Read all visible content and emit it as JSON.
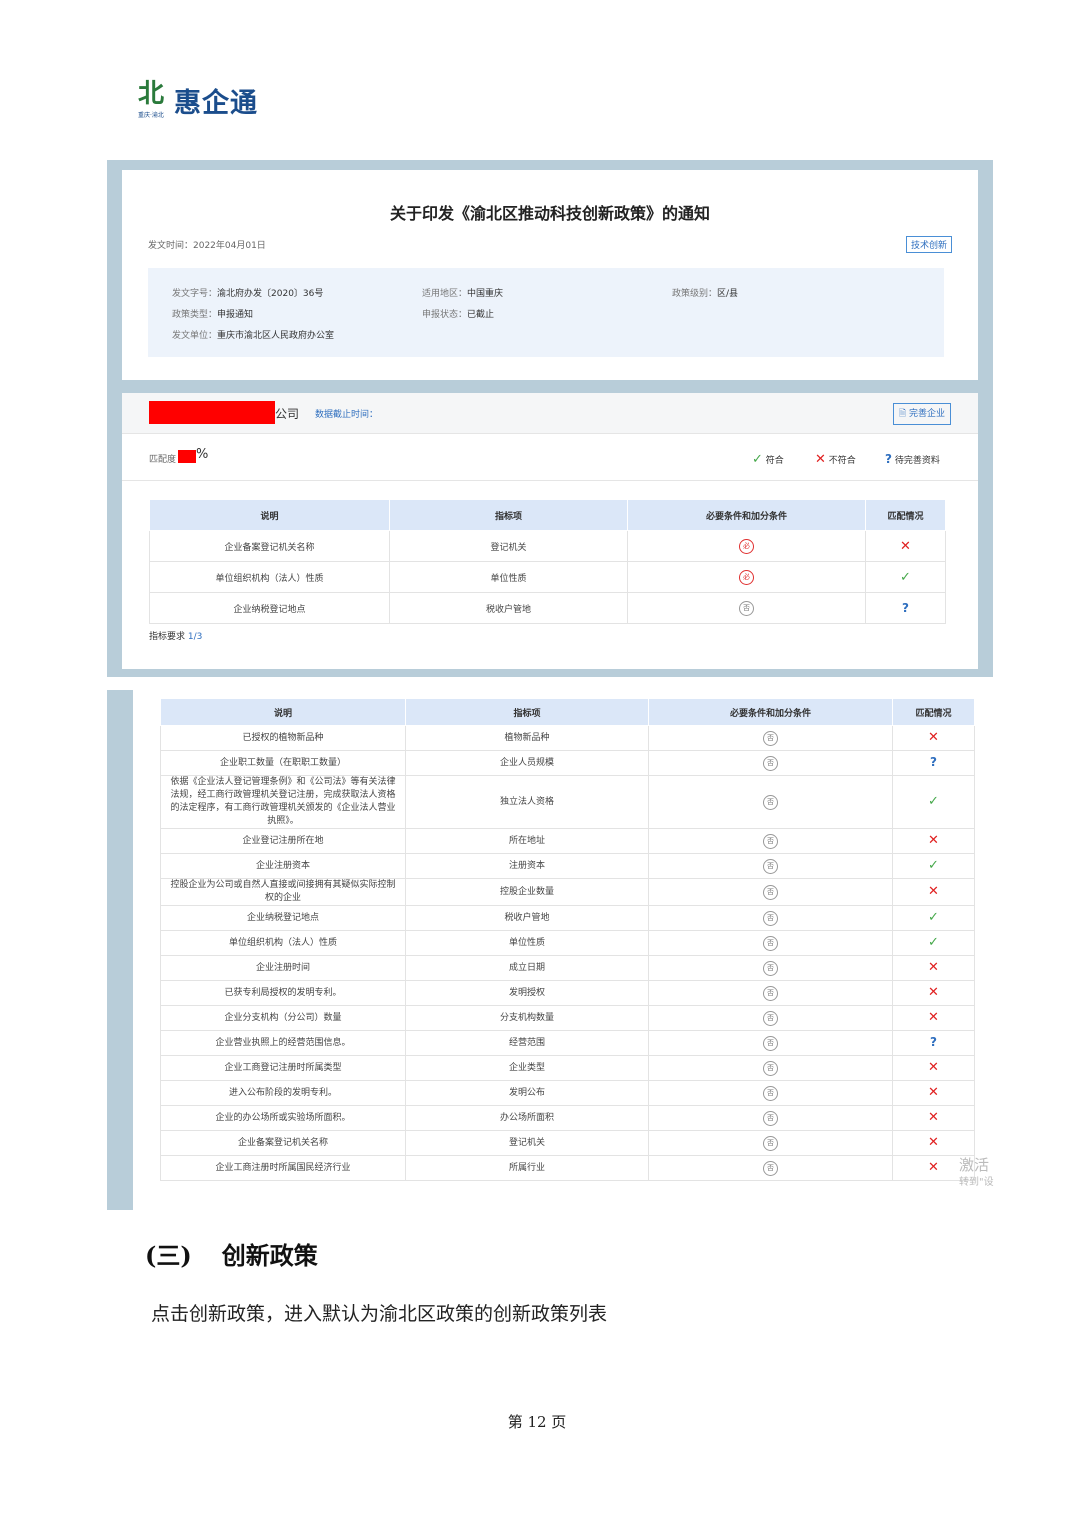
{
  "logo": {
    "glyph": "北",
    "sub": "重庆·渝北",
    "name": "惠企通"
  },
  "policy": {
    "title": "关于印发《渝北区推动科技创新政策》的通知",
    "date_label": "发文时间：2022年04月01日",
    "tag": "技术创新",
    "fields": {
      "doc_no_k": "发文字号：",
      "doc_no_v": "渝北府办发〔2020〕36号",
      "region_k": "适用地区：",
      "region_v": "中国重庆",
      "level_k": "政策级别：",
      "level_v": "区/县",
      "type_k": "政策类型：",
      "type_v": "申报通知",
      "status_k": "申报状态：",
      "status_v": "已截止",
      "issuer_k": "发文单位：",
      "issuer_v": "重庆市渝北区人民政府办公室"
    }
  },
  "match": {
    "company_suffix": "公司",
    "deadline_label": "数据截止时间：",
    "perfect_button": "完善企业",
    "degree_label": "匹配度",
    "degree_suffix": "%",
    "legend": {
      "ok": "符合",
      "no": "不符合",
      "pending": "待完善资料"
    },
    "headers": [
      "说明",
      "指标项",
      "必要条件和加分条件",
      "匹配情况"
    ],
    "rows": [
      {
        "desc": "企业备案登记机关名称",
        "item": "登记机关",
        "cond": "必",
        "status": "no"
      },
      {
        "desc": "单位组织机构（法人）性质",
        "item": "单位性质",
        "cond": "必",
        "status": "ok"
      },
      {
        "desc": "企业纳税登记地点",
        "item": "税收户管地",
        "cond": "否",
        "status": "pending"
      }
    ],
    "requirement_label": "指标要求",
    "requirement_value": "1/3"
  },
  "table2": {
    "headers": [
      "说明",
      "指标项",
      "必要条件和加分条件",
      "匹配情况"
    ],
    "rows": [
      {
        "desc": "已授权的植物新品种",
        "item": "植物新品种",
        "cond": "否",
        "status": "no"
      },
      {
        "desc": "企业职工数量（在职职工数量）",
        "item": "企业人员规模",
        "cond": "否",
        "status": "pending"
      },
      {
        "desc": "依据《企业法人登记管理条例》和《公司法》等有关法律法规，经工商行政管理机关登记注册，完成获取法人资格的法定程序，有工商行政管理机关颁发的《企业法人营业执照》。",
        "item": "独立法人资格",
        "cond": "否",
        "status": "ok"
      },
      {
        "desc": "企业登记注册所在地",
        "item": "所在地址",
        "cond": "否",
        "status": "no"
      },
      {
        "desc": "企业注册资本",
        "item": "注册资本",
        "cond": "否",
        "status": "ok"
      },
      {
        "desc": "控股企业为公司或自然人直接或间接拥有其疑似实际控制权的企业",
        "item": "控股企业数量",
        "cond": "否",
        "status": "no"
      },
      {
        "desc": "企业纳税登记地点",
        "item": "税收户管地",
        "cond": "否",
        "status": "ok"
      },
      {
        "desc": "单位组织机构（法人）性质",
        "item": "单位性质",
        "cond": "否",
        "status": "ok"
      },
      {
        "desc": "企业注册时间",
        "item": "成立日期",
        "cond": "否",
        "status": "no"
      },
      {
        "desc": "已获专利局授权的发明专利。",
        "item": "发明授权",
        "cond": "否",
        "status": "no"
      },
      {
        "desc": "企业分支机构（分公司）数量",
        "item": "分支机构数量",
        "cond": "否",
        "status": "no"
      },
      {
        "desc": "企业营业执照上的经营范围信息。",
        "item": "经营范围",
        "cond": "否",
        "status": "pending"
      },
      {
        "desc": "企业工商登记注册时所属类型",
        "item": "企业类型",
        "cond": "否",
        "status": "no"
      },
      {
        "desc": "进入公布阶段的发明专利。",
        "item": "发明公布",
        "cond": "否",
        "status": "no"
      },
      {
        "desc": "企业的办公场所或实验场所面积。",
        "item": "办公场所面积",
        "cond": "否",
        "status": "no"
      },
      {
        "desc": "企业备案登记机关名称",
        "item": "登记机关",
        "cond": "否",
        "status": "no"
      },
      {
        "desc": "企业工商注册时所属国民经济行业",
        "item": "所属行业",
        "cond": "否",
        "status": "no"
      }
    ]
  },
  "watermark": {
    "line1": "激活",
    "line2": "转到\"设"
  },
  "section": {
    "num": "(三)",
    "title": "创新政策"
  },
  "paragraph": "点击创新政策，进入默认为渝北区政策的创新政策列表",
  "page_number": "第 12 页",
  "colors": {
    "brand_blue": "#1b4d8c",
    "brand_green": "#2a7a3b",
    "link": "#2f6fbf",
    "redact": "#ff0000",
    "frame": "#b8cdd9"
  }
}
